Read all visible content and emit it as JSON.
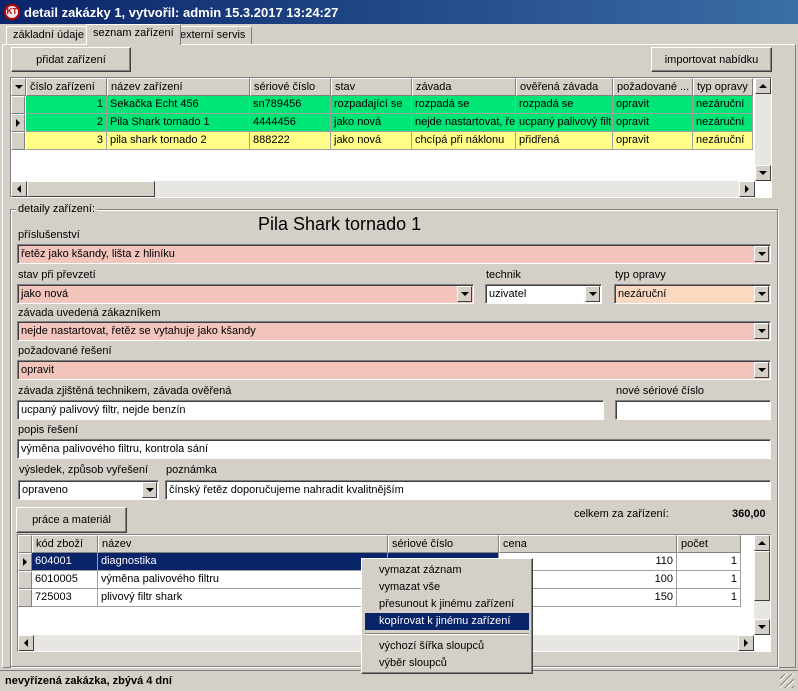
{
  "window": {
    "title": "detail zakázky 1, vytvořil: admin 15.3.2017 13:24:27",
    "logo_text": "KT"
  },
  "tabs": [
    {
      "label": "základní údaje"
    },
    {
      "label": "seznam zařízení"
    },
    {
      "label": "externí servis"
    }
  ],
  "toolbar": {
    "add_device": "přidat zařízení",
    "import_offer": "importovat nabídku"
  },
  "devices_table": {
    "columns": [
      "číslo zařízení",
      "název zařízení",
      "sériové číslo",
      "stav",
      "závada",
      "ověřená závada",
      "požadované ...",
      "typ opravy"
    ],
    "rows": [
      {
        "cislo": "1",
        "nazev": "Sekačka Echt 456",
        "seriove": "sn789456",
        "stav": "rozpadající se",
        "zavada": "rozpadá se",
        "overena": "rozpadá se",
        "pozadovane": "opravit",
        "typ": "nezáruční",
        "color": "#00e676"
      },
      {
        "cislo": "2",
        "nazev": "Pila Shark tornado 1",
        "seriove": "4444456",
        "stav": "jako nová",
        "zavada": "nejde nastartovat, ře",
        "overena": "ucpaný palivový filt",
        "pozadovane": "opravit",
        "typ": "nezáruční",
        "color": "#00e676"
      },
      {
        "cislo": "3",
        "nazev": "pila shark tornado 2",
        "seriove": "888222",
        "stav": "jako nová",
        "zavada": "chcípá při náklonu",
        "overena": "přidřená",
        "pozadovane": "opravit",
        "typ": "nezáruční",
        "color": "#ffff88"
      }
    ]
  },
  "details": {
    "group_label": "detaily zařízení:",
    "device_title": "Pila Shark tornado 1",
    "prislusenstvi_label": "příslušenství",
    "prislusenstvi_value": "řetěz jako kšandy, lišta z hliníku",
    "stav_label": "stav při převzetí",
    "stav_value": "jako nová",
    "technik_label": "technik",
    "technik_value": "uzivatel",
    "typ_opravy_label": "typ opravy",
    "typ_opravy_value": "nezáruční",
    "zavada_label": "závada uvedená zákazníkem",
    "zavada_value": "nejde nastartovat, řetěz se vytahuje jako kšandy",
    "pozadovane_label": "požadované řešení",
    "pozadovane_value": "opravit",
    "zjistena_label": "závada zjištěná technikem, závada ověřená",
    "zjistena_value": "ucpaný palivový filtr, nejde benzín",
    "nove_seriove_label": "nové sériové číslo",
    "nove_seriove_value": "",
    "popis_label": "popis řešení",
    "popis_value": "výměna palivového filtru, kontrola sání",
    "vysledek_label": "výsledek, způsob vyřešení",
    "vysledek_value": "opraveno",
    "poznamka_label": "poznámka",
    "poznamka_value": "čínský řetěz doporučujeme nahradit kvalitnějším",
    "prace_button": "práce a materiál",
    "celkem_label": "celkem za zařízení:",
    "celkem_value": "360,00"
  },
  "items_table": {
    "columns": [
      "kód zboží",
      "název",
      "sériové číslo",
      "cena",
      "počet"
    ],
    "rows": [
      {
        "kod": "604001",
        "nazev": "diagnostika",
        "seriove": "",
        "cena": "110",
        "pocet": "1"
      },
      {
        "kod": "6010005",
        "nazev": "výměna palivového filtru",
        "seriove": "",
        "cena": "100",
        "pocet": "1"
      },
      {
        "kod": "725003",
        "nazev": "plivový filtr shark",
        "seriove": "",
        "cena": "150",
        "pocet": "1"
      }
    ]
  },
  "context_menu": {
    "items": [
      "vymazat záznam",
      "vymazat vše",
      "přesunout k jinému zařízení",
      "kopírovat k jinému zařízení"
    ],
    "items2": [
      "výchozí šířka sloupců",
      "výběr sloupců"
    ]
  },
  "status": {
    "text": "nevyřízená zakázka, zbývá 4 dní"
  }
}
